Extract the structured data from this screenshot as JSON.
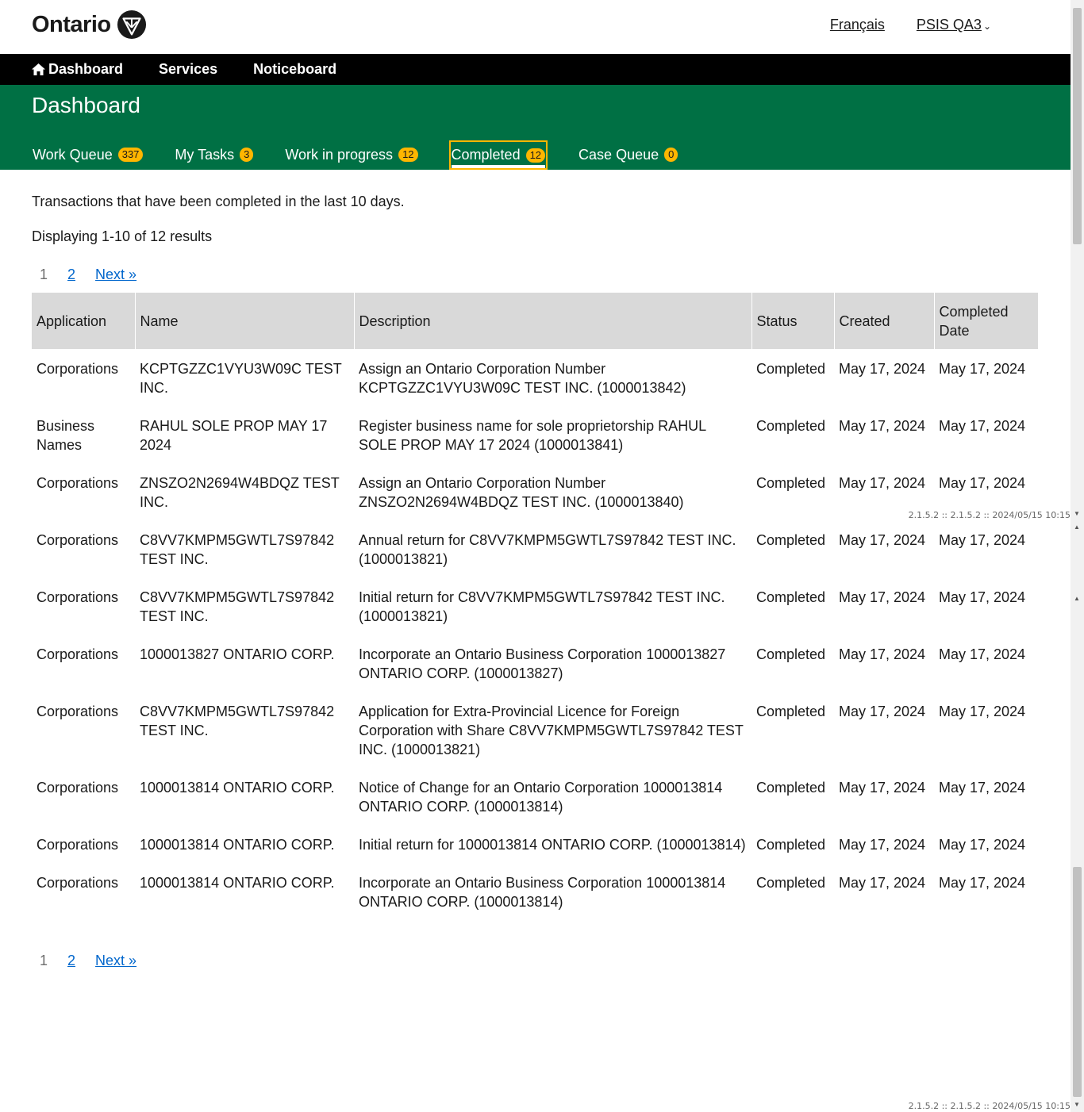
{
  "header": {
    "logo_text": "Ontario",
    "lang_link": "Français",
    "env_menu": "PSIS QA3"
  },
  "nav": {
    "dashboard": "Dashboard",
    "services": "Services",
    "noticeboard": "Noticeboard"
  },
  "page": {
    "title": "Dashboard"
  },
  "tabs": [
    {
      "label": "Work Queue",
      "count": "337"
    },
    {
      "label": "My Tasks",
      "count": "3"
    },
    {
      "label": "Work in progress",
      "count": "12"
    },
    {
      "label": "Completed",
      "count": "12"
    },
    {
      "label": "Case Queue",
      "count": "0"
    }
  ],
  "intro": "Transactions that have been completed in the last 10 days.",
  "results": "Displaying 1-10 of 12 results",
  "pager": {
    "current": "1",
    "page2": "2",
    "next": "Next »"
  },
  "table": {
    "headers": [
      "Application",
      "Name",
      "Description",
      "Status",
      "Created",
      "Completed Date"
    ],
    "rows": [
      [
        "Corporations",
        "KCPTGZZC1VYU3W09C TEST INC.",
        "Assign an Ontario Corporation Number KCPTGZZC1VYU3W09C TEST INC. (1000013842)",
        "Completed",
        "May 17, 2024",
        "May 17, 2024"
      ],
      [
        "Business Names",
        "RAHUL SOLE PROP MAY 17 2024",
        "Register business name for sole proprietorship RAHUL SOLE PROP MAY 17 2024 (1000013841)",
        "Completed",
        "May 17, 2024",
        "May 17, 2024"
      ],
      [
        "Corporations",
        "ZNSZO2N2694W4BDQZ TEST INC.",
        "Assign an Ontario Corporation Number ZNSZO2N2694W4BDQZ TEST INC. (1000013840)",
        "Completed",
        "May 17, 2024",
        "May 17, 2024"
      ],
      [
        "Corporations",
        "C8VV7KMPM5GWTL7S97842 TEST INC.",
        "Annual return for C8VV7KMPM5GWTL7S97842 TEST INC. (1000013821)",
        "Completed",
        "May 17, 2024",
        "May 17, 2024"
      ],
      [
        "Corporations",
        "C8VV7KMPM5GWTL7S97842 TEST INC.",
        "Initial return for C8VV7KMPM5GWTL7S97842 TEST INC. (1000013821)",
        "Completed",
        "May 17, 2024",
        "May 17, 2024"
      ],
      [
        "Corporations",
        "1000013827 ONTARIO CORP.",
        "Incorporate an Ontario Business Corporation 1000013827 ONTARIO CORP. (1000013827)",
        "Completed",
        "May 17, 2024",
        "May 17, 2024"
      ],
      [
        "Corporations",
        "C8VV7KMPM5GWTL7S97842 TEST INC.",
        "Application for Extra-Provincial Licence for Foreign Corporation with Share C8VV7KMPM5GWTL7S97842 TEST INC. (1000013821)",
        "Completed",
        "May 17, 2024",
        "May 17, 2024"
      ],
      [
        "Corporations",
        "1000013814 ONTARIO CORP.",
        "Notice of Change for an Ontario Corporation 1000013814 ONTARIO CORP. (1000013814)",
        "Completed",
        "May 17, 2024",
        "May 17, 2024"
      ],
      [
        "Corporations",
        "1000013814 ONTARIO CORP.",
        "Initial return for 1000013814 ONTARIO CORP. (1000013814)",
        "Completed",
        "May 17, 2024",
        "May 17, 2024"
      ],
      [
        "Corporations",
        "1000013814 ONTARIO CORP.",
        "Incorporate an Ontario Business Corporation 1000013814 ONTARIO CORP. (1000013814)",
        "Completed",
        "May 17, 2024",
        "May 17, 2024"
      ]
    ]
  },
  "version": "2.1.5.2 :: 2.1.5.2 :: 2024/05/15 10:15"
}
